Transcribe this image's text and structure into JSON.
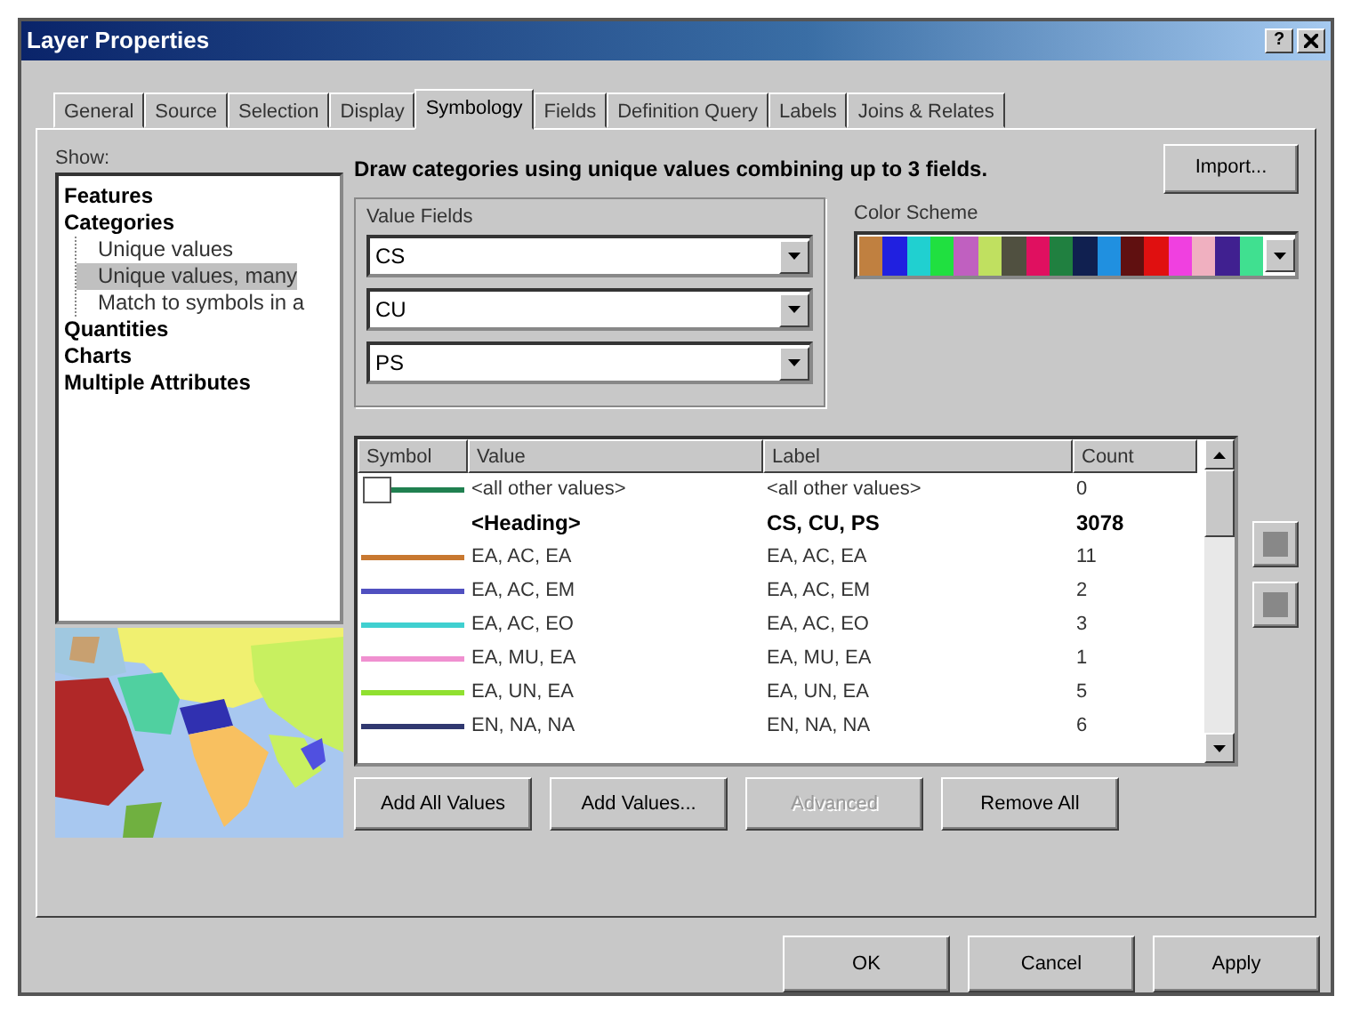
{
  "window": {
    "title": "Layer Properties",
    "help": "?"
  },
  "tabs": [
    {
      "label": "General",
      "selected": false
    },
    {
      "label": "Source",
      "selected": false
    },
    {
      "label": "Selection",
      "selected": false
    },
    {
      "label": "Display",
      "selected": false
    },
    {
      "label": "Symbology",
      "selected": true
    },
    {
      "label": "Fields",
      "selected": false
    },
    {
      "label": "Definition Query",
      "selected": false
    },
    {
      "label": "Labels",
      "selected": false
    },
    {
      "label": "Joins & Relates",
      "selected": false
    }
  ],
  "show": {
    "label": "Show:",
    "tree": [
      {
        "label": "Features",
        "selected": false
      },
      {
        "label": "Categories",
        "selected": false,
        "children": [
          {
            "label": "Unique values",
            "selected": false
          },
          {
            "label": "Unique values, many",
            "selected": true
          },
          {
            "label": "Match to symbols in a",
            "selected": false
          }
        ]
      },
      {
        "label": "Quantities",
        "selected": false
      },
      {
        "label": "Charts",
        "selected": false
      },
      {
        "label": "Multiple Attributes",
        "selected": false
      }
    ]
  },
  "description": "Draw categories using unique values combining up to 3 fields.",
  "import_button": "Import...",
  "value_fields": {
    "label": "Value Fields",
    "fields": [
      "CS",
      "CU",
      "PS"
    ]
  },
  "color_scheme": {
    "label": "Color Scheme",
    "colors": [
      {
        "color": "#c08040"
      },
      {
        "color": "#2020e0"
      },
      {
        "color": "#20d0d0"
      },
      {
        "color": "#20e040"
      },
      {
        "color": "#c060c0"
      },
      {
        "color": "#c0e060"
      },
      {
        "color": "#505040"
      },
      {
        "color": "#e01060"
      },
      {
        "color": "#208040"
      },
      {
        "color": "#102050"
      },
      {
        "color": "#2090e0"
      },
      {
        "color": "#601010"
      },
      {
        "color": "#e01010"
      },
      {
        "color": "#f040e0"
      },
      {
        "color": "#f0b0c0"
      },
      {
        "color": "#402090"
      },
      {
        "color": "#40e090"
      }
    ]
  },
  "table": {
    "columns": [
      "Symbol",
      "Value",
      "Label",
      "Count"
    ],
    "rows": [
      {
        "kind": "other",
        "checked": false,
        "color": "#208050",
        "value": "<all other values>",
        "label": "<all other values>",
        "count": "0"
      },
      {
        "kind": "heading",
        "value": "<Heading>",
        "label": "CS, CU, PS",
        "count": "3078"
      },
      {
        "kind": "value",
        "color": "#c87830",
        "value": "EA, AC, EA",
        "label": "EA, AC, EA",
        "count": "11"
      },
      {
        "kind": "value",
        "color": "#5050c0",
        "value": "EA, AC, EM",
        "label": "EA, AC, EM",
        "count": "2"
      },
      {
        "kind": "value",
        "color": "#40d0d0",
        "value": "EA, AC, EO",
        "label": "EA, AC, EO",
        "count": "3"
      },
      {
        "kind": "value",
        "color": "#f090d0",
        "value": "EA, MU, EA",
        "label": "EA, MU, EA",
        "count": "1"
      },
      {
        "kind": "value",
        "color": "#90e030",
        "value": "EA, UN, EA",
        "label": "EA, UN, EA",
        "count": "5"
      },
      {
        "kind": "value",
        "color": "#303870",
        "value": "EN, NA, NA",
        "label": "EN, NA, NA",
        "count": "6"
      }
    ]
  },
  "buttons": [
    {
      "label": "Add All Values",
      "disabled": false
    },
    {
      "label": "Add Values...",
      "disabled": false
    },
    {
      "label": "Advanced",
      "disabled": true
    },
    {
      "label": "Remove All",
      "disabled": false
    }
  ],
  "footer_buttons": [
    "OK",
    "Cancel",
    "Apply"
  ]
}
